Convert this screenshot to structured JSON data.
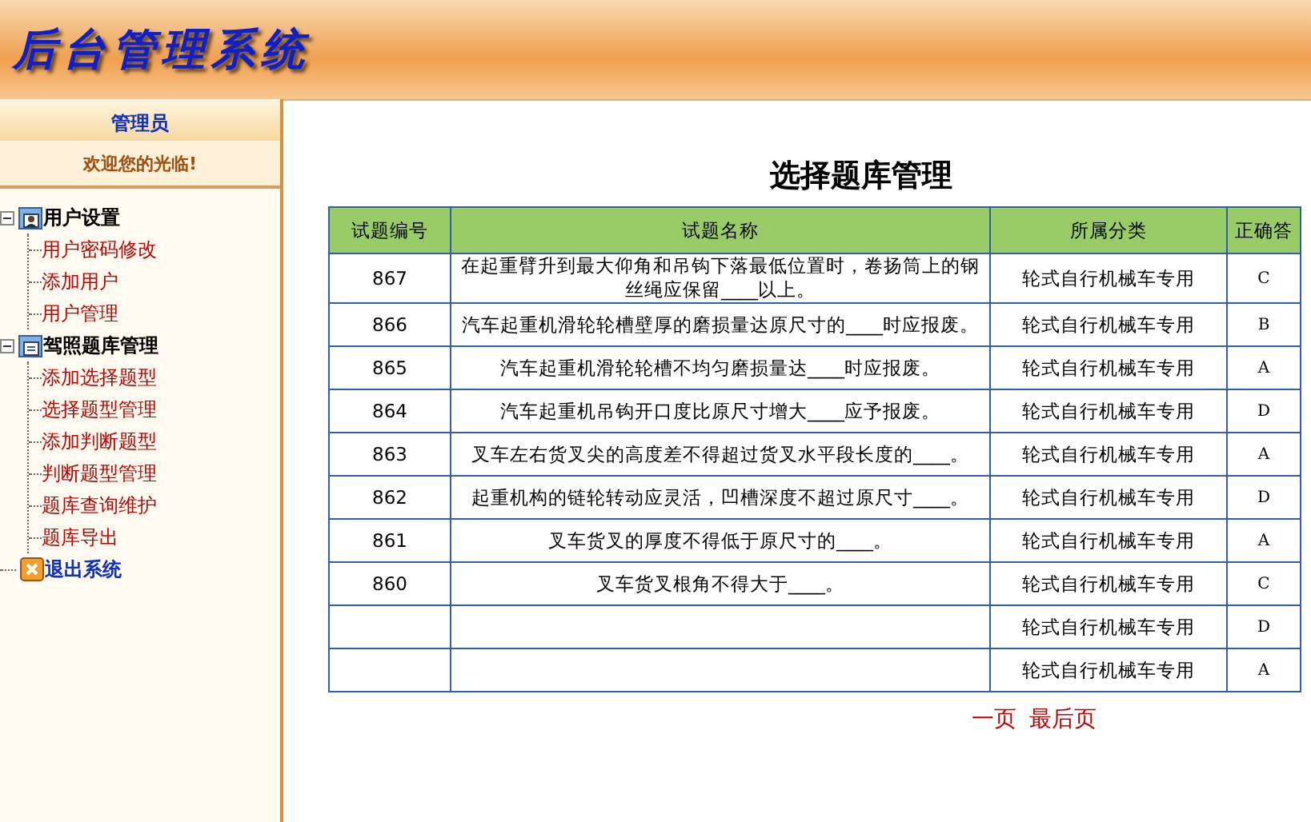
{
  "header": {
    "title": "后台管理系统"
  },
  "sidebar": {
    "tab": "管理员",
    "welcome": "欢迎您的光临!",
    "tree": [
      {
        "label": "用户设置",
        "kind": "user",
        "expanded": true,
        "children": [
          {
            "label": "用户密码修改"
          },
          {
            "label": "添加用户"
          },
          {
            "label": "用户管理"
          }
        ]
      },
      {
        "label": "驾照题库管理",
        "kind": "doc",
        "expanded": true,
        "children": [
          {
            "label": "添加选择题型"
          },
          {
            "label": "选择题型管理"
          },
          {
            "label": "添加判断题型"
          },
          {
            "label": "判断题型管理"
          },
          {
            "label": "题库查询维护"
          },
          {
            "label": "题库导出"
          }
        ]
      },
      {
        "label": "退出系统",
        "kind": "exit"
      }
    ]
  },
  "main": {
    "title": "选择题库管理",
    "table": {
      "columns": [
        "试题编号",
        "试题名称",
        "所属分类",
        "正确答"
      ],
      "rows": [
        {
          "id": "867",
          "name": "在起重臂升到最大仰角和吊钩下落最低位置时，卷扬筒上的钢丝绳应保留____以上。",
          "category": "轮式自行机械车专用",
          "answer": "C"
        },
        {
          "id": "866",
          "name": "汽车起重机滑轮轮槽壁厚的磨损量达原尺寸的____时应报废。",
          "category": "轮式自行机械车专用",
          "answer": "B"
        },
        {
          "id": "865",
          "name": "汽车起重机滑轮轮槽不均匀磨损量达____时应报废。",
          "category": "轮式自行机械车专用",
          "answer": "A"
        },
        {
          "id": "864",
          "name": "汽车起重机吊钩开口度比原尺寸增大____应予报废。",
          "category": "轮式自行机械车专用",
          "answer": "D"
        },
        {
          "id": "863",
          "name": "叉车左右货叉尖的高度差不得超过货叉水平段长度的____。",
          "category": "轮式自行机械车专用",
          "answer": "A"
        },
        {
          "id": "862",
          "name": "起重机构的链轮转动应灵活，凹槽深度不超过原尺寸____。",
          "category": "轮式自行机械车专用",
          "answer": "D"
        },
        {
          "id": "861",
          "name": "叉车货叉的厚度不得低于原尺寸的____。",
          "category": "轮式自行机械车专用",
          "answer": "A"
        },
        {
          "id": "860",
          "name": "叉车货叉根角不得大于____。",
          "category": "轮式自行机械车专用",
          "answer": "C"
        },
        {
          "category": "轮式自行机械车专用",
          "answer": "D"
        },
        {
          "category": "轮式自行机械车专用",
          "answer": "A"
        }
      ]
    },
    "pagination": [
      "一页",
      "最后页"
    ]
  }
}
